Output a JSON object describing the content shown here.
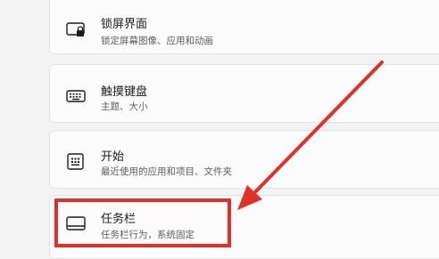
{
  "settings": [
    {
      "title": "锁屏界面",
      "description": "锁定屏幕图像、应用和动画",
      "icon": "lock-screen-icon"
    },
    {
      "title": "触摸键盘",
      "description": "主题、大小",
      "icon": "keyboard-icon"
    },
    {
      "title": "开始",
      "description": "最近使用的应用和项目、文件夹",
      "icon": "start-menu-icon"
    },
    {
      "title": "任务栏",
      "description": "任务栏行为，系统固定",
      "icon": "taskbar-icon"
    }
  ],
  "colors": {
    "annotation": "#e0302b",
    "card": "#fbfbfb",
    "background": "#f3f3f3"
  }
}
